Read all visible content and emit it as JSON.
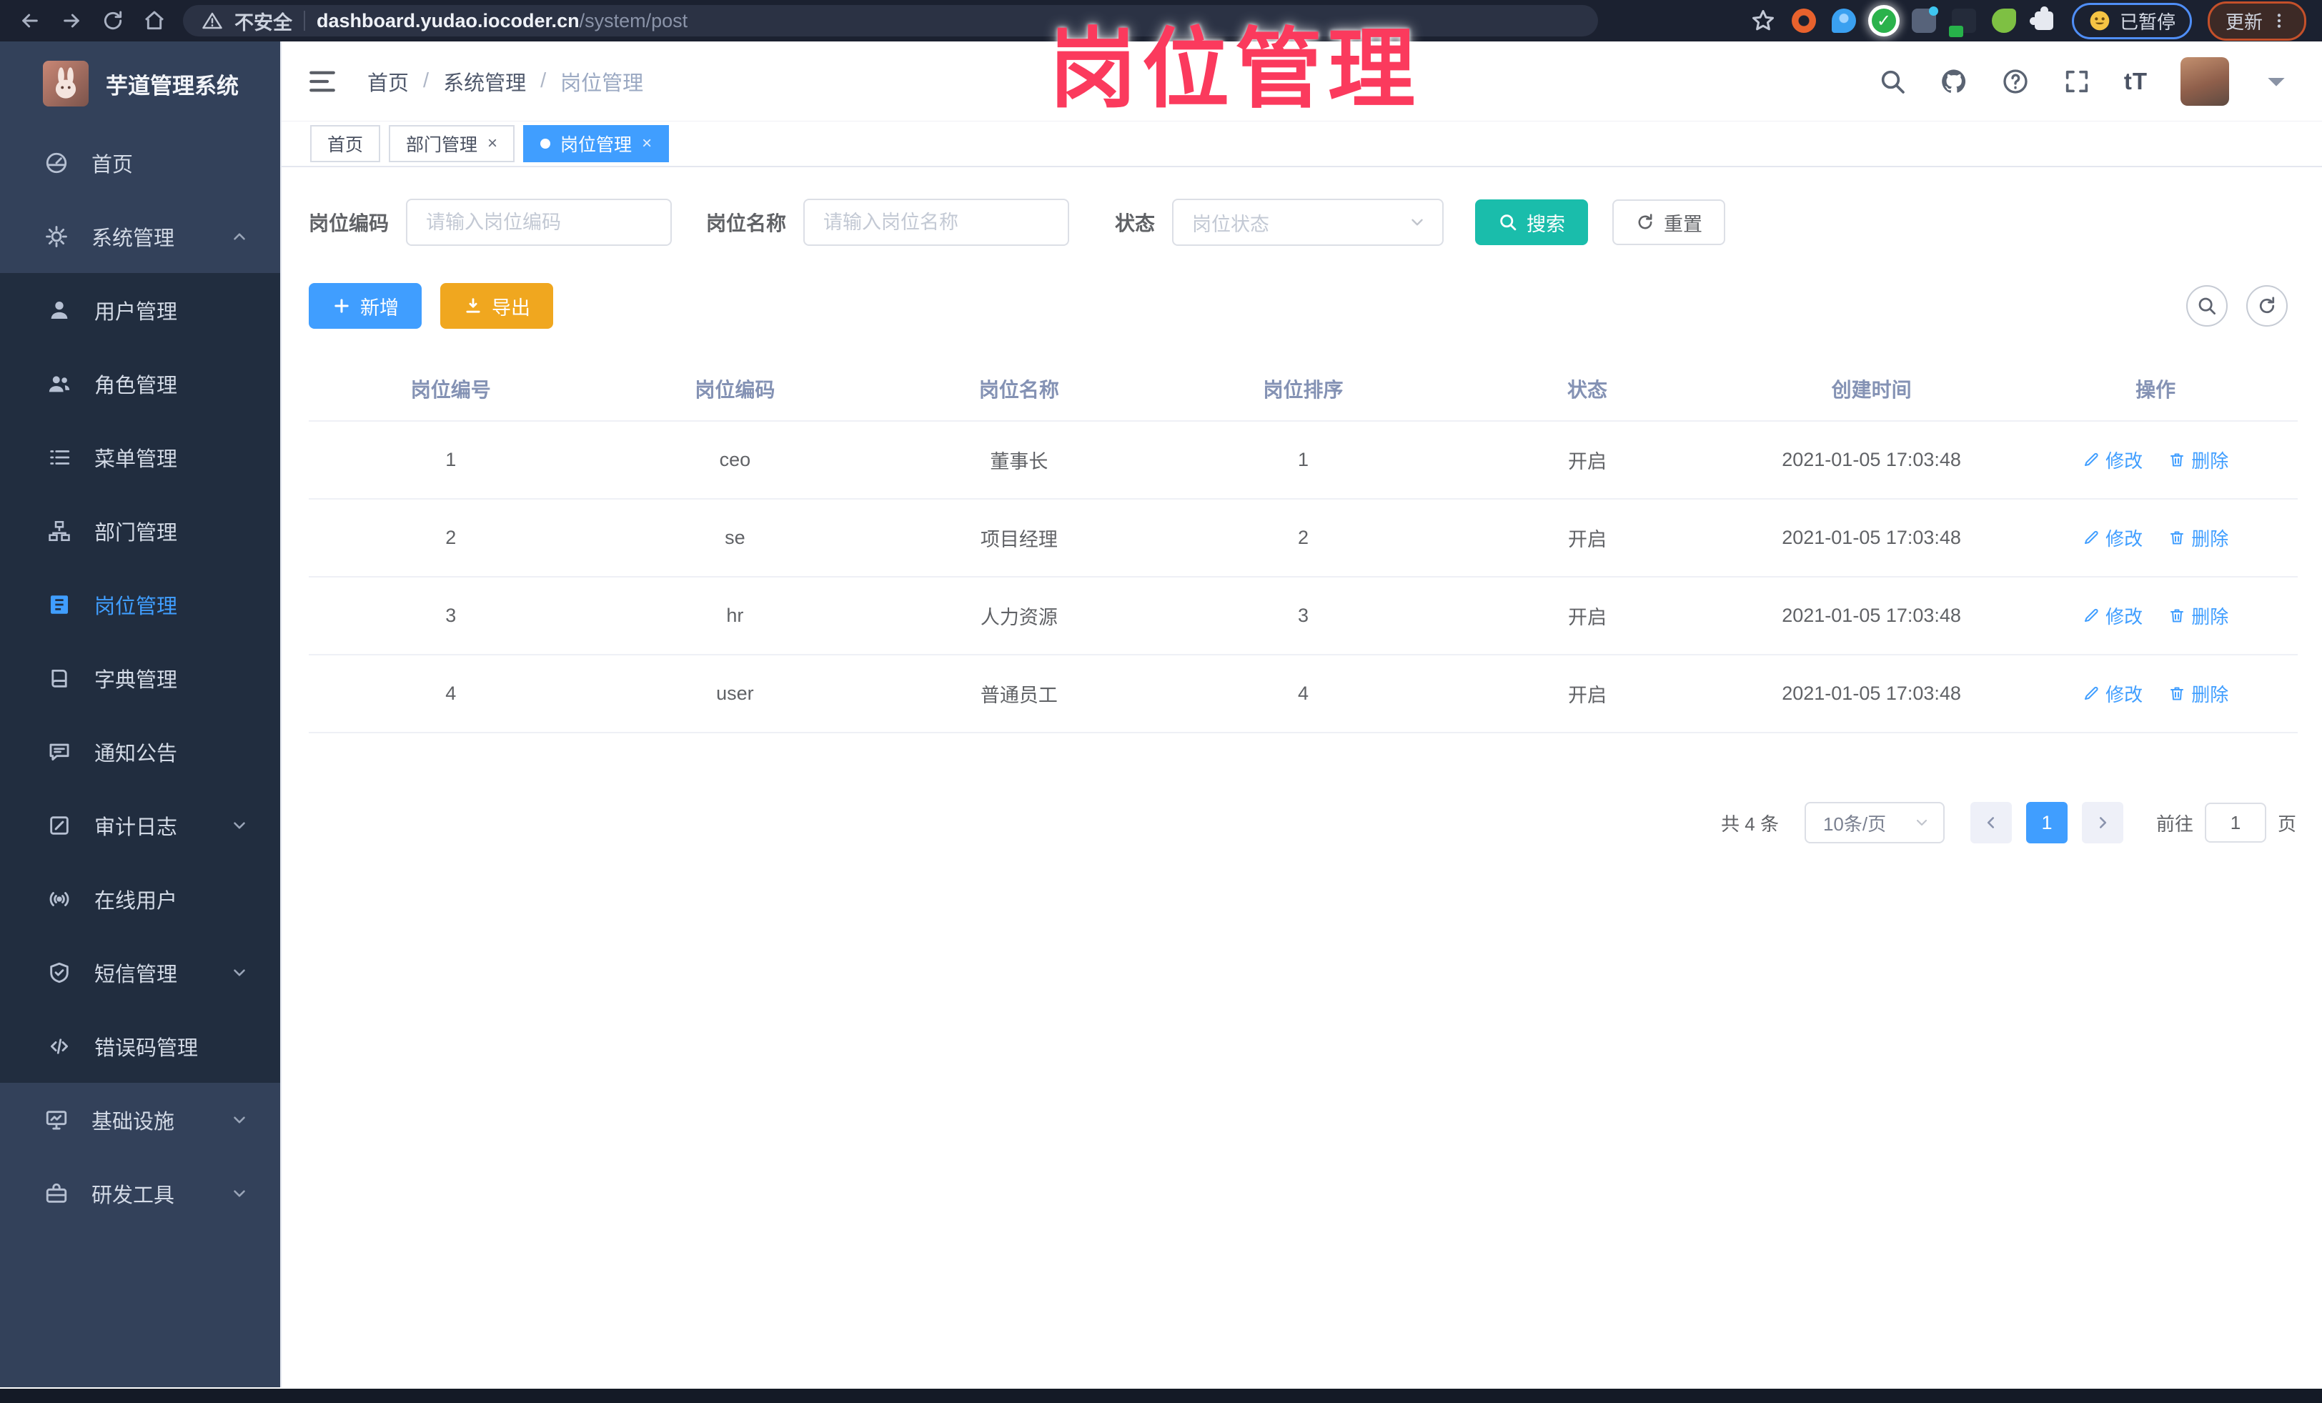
{
  "colors": {
    "accent": "#409eff",
    "search_button": "#1abdab",
    "export_button": "#f0a71f",
    "overlay_text": "#fb3a5d",
    "sidebar_bg": "#33415a",
    "submenu_bg": "#212d3f"
  },
  "overlay": {
    "title": "岗位管理"
  },
  "browser": {
    "security_label": "不安全",
    "url_host": "dashboard.yudao.iocoder.cn",
    "url_path": "/system/post",
    "paused_label": "已暂停",
    "update_label": "更新"
  },
  "sidebar": {
    "app_title": "芋道管理系统",
    "items": [
      {
        "label": "首页",
        "icon": "dashboard",
        "level": "top"
      },
      {
        "label": "系统管理",
        "icon": "gear",
        "level": "top",
        "chevron": "up"
      },
      {
        "label": "用户管理",
        "icon": "user",
        "level": "sub"
      },
      {
        "label": "角色管理",
        "icon": "users",
        "level": "sub"
      },
      {
        "label": "菜单管理",
        "icon": "menu-list",
        "level": "sub"
      },
      {
        "label": "部门管理",
        "icon": "org-tree",
        "level": "sub"
      },
      {
        "label": "岗位管理",
        "icon": "post-badge",
        "level": "sub",
        "active": true
      },
      {
        "label": "字典管理",
        "icon": "dict-book",
        "level": "sub"
      },
      {
        "label": "通知公告",
        "icon": "notice",
        "level": "sub"
      },
      {
        "label": "审计日志",
        "icon": "audit-log",
        "level": "sub",
        "chevron": "down"
      },
      {
        "label": "在线用户",
        "icon": "online-user",
        "level": "sub"
      },
      {
        "label": "短信管理",
        "icon": "sms-shield",
        "level": "sub",
        "chevron": "down"
      },
      {
        "label": "错误码管理",
        "icon": "error-code",
        "level": "sub"
      },
      {
        "label": "基础设施",
        "icon": "infra-monitor",
        "level": "top",
        "chevron": "down"
      },
      {
        "label": "研发工具",
        "icon": "dev-tool",
        "level": "top",
        "chevron": "down"
      }
    ]
  },
  "header": {
    "breadcrumbs": [
      "首页",
      "系统管理",
      "岗位管理"
    ],
    "font_size_icon_text": "tT"
  },
  "tabs": [
    {
      "label": "首页",
      "closable": false,
      "active": false
    },
    {
      "label": "部门管理",
      "closable": true,
      "active": false
    },
    {
      "label": "岗位管理",
      "closable": true,
      "active": true
    }
  ],
  "filters": {
    "code_label": "岗位编码",
    "code_placeholder": "请输入岗位编码",
    "name_label": "岗位名称",
    "name_placeholder": "请输入岗位名称",
    "status_label": "状态",
    "status_placeholder": "岗位状态",
    "search_label": "搜索",
    "reset_label": "重置"
  },
  "toolbar": {
    "add_label": "新增",
    "export_label": "导出"
  },
  "table": {
    "columns": [
      "岗位编号",
      "岗位编码",
      "岗位名称",
      "岗位排序",
      "状态",
      "创建时间",
      "操作"
    ],
    "rows": [
      {
        "id": "1",
        "code": "ceo",
        "name": "董事长",
        "sort": "1",
        "status": "开启",
        "created": "2021-01-05 17:03:48"
      },
      {
        "id": "2",
        "code": "se",
        "name": "项目经理",
        "sort": "2",
        "status": "开启",
        "created": "2021-01-05 17:03:48"
      },
      {
        "id": "3",
        "code": "hr",
        "name": "人力资源",
        "sort": "3",
        "status": "开启",
        "created": "2021-01-05 17:03:48"
      },
      {
        "id": "4",
        "code": "user",
        "name": "普通员工",
        "sort": "4",
        "status": "开启",
        "created": "2021-01-05 17:03:48"
      }
    ],
    "edit_label": "修改",
    "delete_label": "删除"
  },
  "pagination": {
    "total_label": "共 4 条",
    "page_size_label": "10条/页",
    "current_page": "1",
    "goto_label": "前往",
    "goto_value": "1",
    "page_unit_label": "页"
  }
}
